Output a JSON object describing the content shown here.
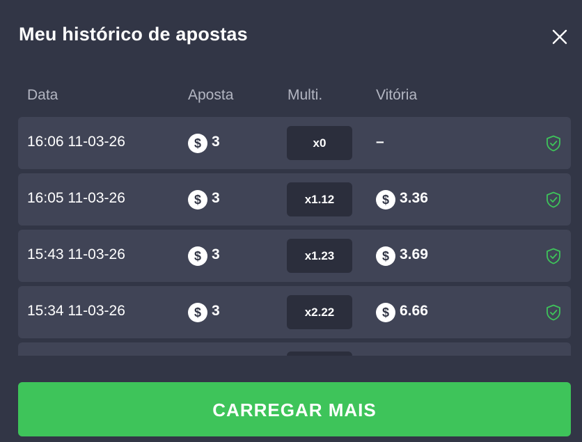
{
  "header": {
    "title": "Meu histórico de apostas",
    "close_icon": "close-icon"
  },
  "columns": {
    "date": "Data",
    "bet": "Aposta",
    "multi": "Multi.",
    "win": "Vitória"
  },
  "currency_symbol": "$",
  "rows": [
    {
      "date": "16:06 11-03-26",
      "bet": "3",
      "multi": "x0",
      "win": "–",
      "won": false
    },
    {
      "date": "16:05 11-03-26",
      "bet": "3",
      "multi": "x1.12",
      "win": "3.36",
      "won": true
    },
    {
      "date": "15:43 11-03-26",
      "bet": "3",
      "multi": "x1.23",
      "win": "3.69",
      "won": true
    },
    {
      "date": "15:34 11-03-26",
      "bet": "3",
      "multi": "x2.22",
      "win": "6.66",
      "won": true
    }
  ],
  "load_more_label": "CARREGAR MAIS",
  "colors": {
    "background": "#323646",
    "row": "#404456",
    "accent_green": "#3ec45a",
    "shield": "#3ec45a"
  }
}
